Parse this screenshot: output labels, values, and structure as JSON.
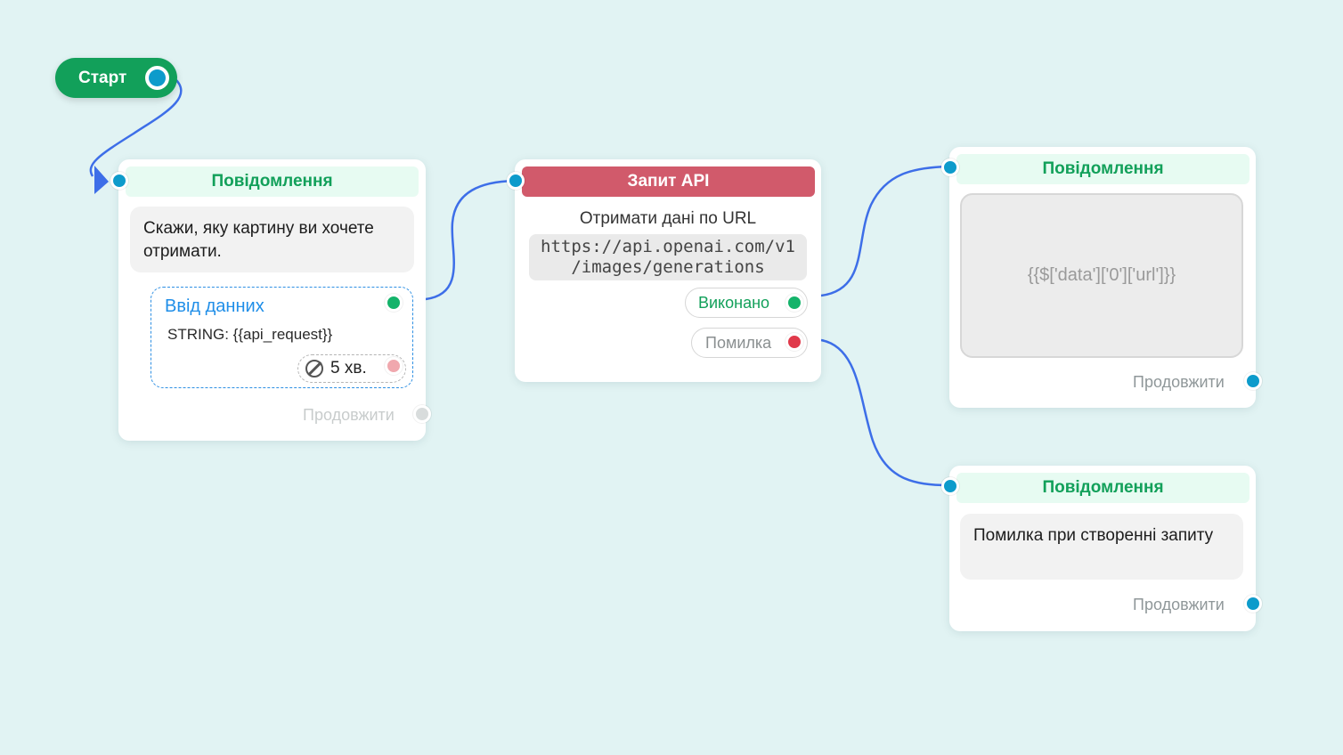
{
  "start": {
    "label": "Старт"
  },
  "node_message_1": {
    "header": "Повідомлення",
    "text": "Скажи, яку картину ви хочете отримати.",
    "input_block": {
      "title": "Ввід данних",
      "variable": "STRING: {{api_request}}",
      "timeout": "5 хв."
    },
    "continue_label": "Продовжити"
  },
  "node_api": {
    "header": "Запит API",
    "subtitle": "Отримати дані по URL",
    "url_line1": "https://api.openai.com/v1",
    "url_line2": "/images/generations",
    "done_label": "Виконано",
    "error_label": "Помилка"
  },
  "node_message_2": {
    "header": "Повідомлення",
    "media_text": "{{$['data']['0']['url']}}",
    "continue_label": "Продовжити"
  },
  "node_message_3": {
    "header": "Повідомлення",
    "text": "Помилка при створенні запиту",
    "continue_label": "Продовжити"
  },
  "colors": {
    "background": "#e1f3f3",
    "brand_green": "#12a05a",
    "api_red": "#d15a6b",
    "connector_blue": "#0d9bcb",
    "wire_blue": "#3d6ee8",
    "link_blue": "#1f8ee8"
  }
}
